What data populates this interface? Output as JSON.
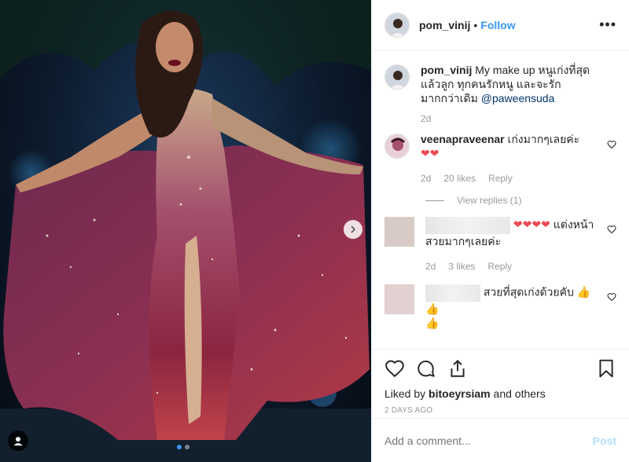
{
  "header": {
    "username": "pom_vinij",
    "separator": "•",
    "follow_label": "Follow",
    "more_label": "•••"
  },
  "caption": {
    "username": "pom_vinij",
    "text": "My make up หนูเก่งที่สุดแล้วลูก ทุกคนรักหนู และจะรักมากกว่าเดิม",
    "mention": "@paweensuda",
    "age": "2d"
  },
  "comments": [
    {
      "username": "veenapraveenar",
      "text": "เก่งมากๆเลยค่ะ",
      "hearts": "❤❤",
      "age": "2d",
      "likes": "20 likes",
      "reply_label": "Reply",
      "view_replies": "View replies (1)"
    },
    {
      "username": "",
      "text": "แต่งหน้าสวยมากๆเลยค่ะ",
      "hearts": "❤❤❤❤",
      "age": "2d",
      "likes": "3 likes",
      "reply_label": "Reply"
    },
    {
      "username": "",
      "text": "สวยที่สุดเก่งด้วยคับ",
      "thumbs": "👍👍",
      "thumbs2": "👍"
    }
  ],
  "likes": {
    "prefix": "Liked by",
    "user": "bitoeyrsiam",
    "suffix": "and others"
  },
  "timestamp": "2 DAYS AGO",
  "add_comment": {
    "placeholder": "Add a comment...",
    "post_label": "Post"
  },
  "colors": {
    "link": "#3897f0",
    "heart": "#ed4956",
    "muted": "#999999",
    "mention": "#003569"
  },
  "icons": [
    "heart-icon",
    "comment-icon",
    "share-icon",
    "bookmark-icon",
    "user-tag-icon",
    "chevron-right-icon",
    "more-icon"
  ]
}
